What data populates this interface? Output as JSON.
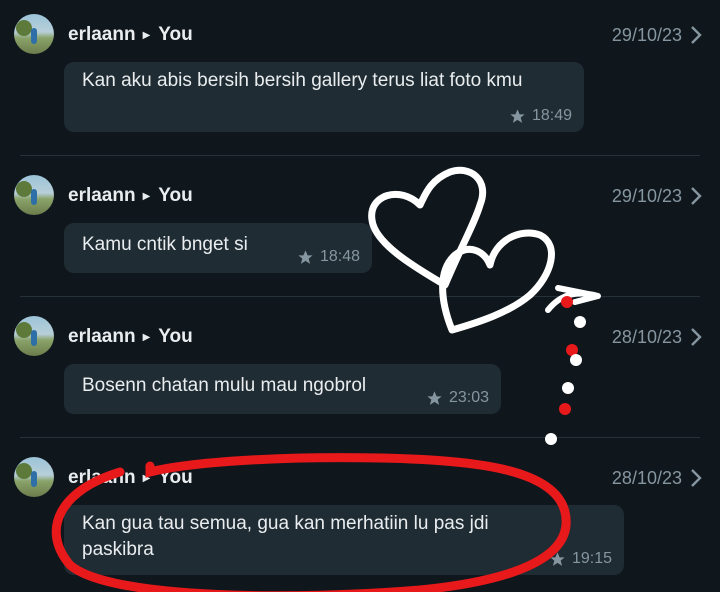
{
  "messages": [
    {
      "sender": "erlaann",
      "recipient": "You",
      "date": "29/10/23",
      "text": "Kan aku abis bersih bersih gallery terus liat foto kmu",
      "time": "18:49"
    },
    {
      "sender": "erlaann",
      "recipient": "You",
      "date": "29/10/23",
      "text": "Kamu cntik bnget si",
      "time": "18:48"
    },
    {
      "sender": "erlaann",
      "recipient": "You",
      "date": "28/10/23",
      "text": "Bosenn chatan mulu mau ngobrol",
      "time": "23:03"
    },
    {
      "sender": "erlaann",
      "recipient": "You",
      "date": "28/10/23",
      "text": "Kan gua tau semua, gua kan merhatiin lu pas jdi paskibra",
      "time": "19:15"
    }
  ],
  "icons": {
    "star": "star-icon",
    "chevron": "chevron-right-icon",
    "arrow": "arrow-right-icon"
  },
  "colors": {
    "background": "#0f161c",
    "bubble": "#1f2c33",
    "meta": "#8696a0",
    "scribble_red": "#e8191a",
    "scribble_white": "#ffffff"
  }
}
